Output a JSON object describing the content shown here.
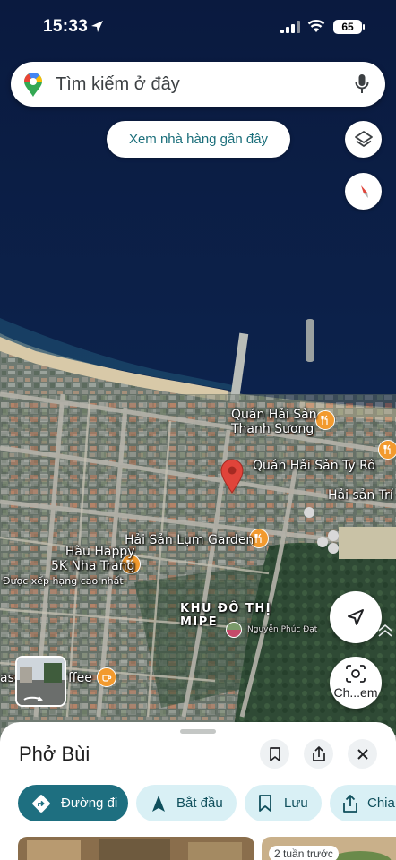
{
  "status_bar": {
    "time": "15:33",
    "battery": "65"
  },
  "search": {
    "placeholder": "Tìm kiếm ở đây"
  },
  "suggestion_chip": {
    "label": "Xem nhà hàng gần đây"
  },
  "map_labels": {
    "quan_hai_san_thanh_suong_1": "Quán Hải Sản",
    "quan_hai_san_thanh_suong_2": "Thanh Sương",
    "quan_hai_san_ty_ro": "Quán Hải Sản Ty Rô",
    "hai_san_tri_n": "Hải sản Trí N",
    "hai_san_lum_garden": "Hải Sản Lụm Garden",
    "hau_happy_1": "Hàu Happy",
    "hau_happy_2": "5K Nha Trang",
    "hau_happy_note": "Được xếp hạng cao nhất",
    "khu_do_thi_1": "KHU ĐÔ THỊ",
    "khu_do_thi_2": "MIPE",
    "nguyen_phuc_dat": "Nguyễn Phúc Đạt",
    "coffee_left": "asc",
    "coffee_right": "ffee"
  },
  "lens_button": {
    "label": "Ch...em"
  },
  "place_sheet": {
    "name": "Phở Bùi",
    "actions": [
      {
        "label": "Đường đi",
        "icon": "directions-icon"
      },
      {
        "label": "Bắt đầu",
        "icon": "navigation-arrow-icon"
      },
      {
        "label": "Lưu",
        "icon": "bookmark-icon"
      },
      {
        "label": "Chia",
        "icon": "share-icon"
      }
    ],
    "photo_age": "2 tuần trước"
  },
  "colors": {
    "sea": "#0b1e44",
    "primary_action": "#1e6f80",
    "secondary_action": "#d9f0f5",
    "poi": "#f29a2e",
    "pin": "#e0443a"
  }
}
